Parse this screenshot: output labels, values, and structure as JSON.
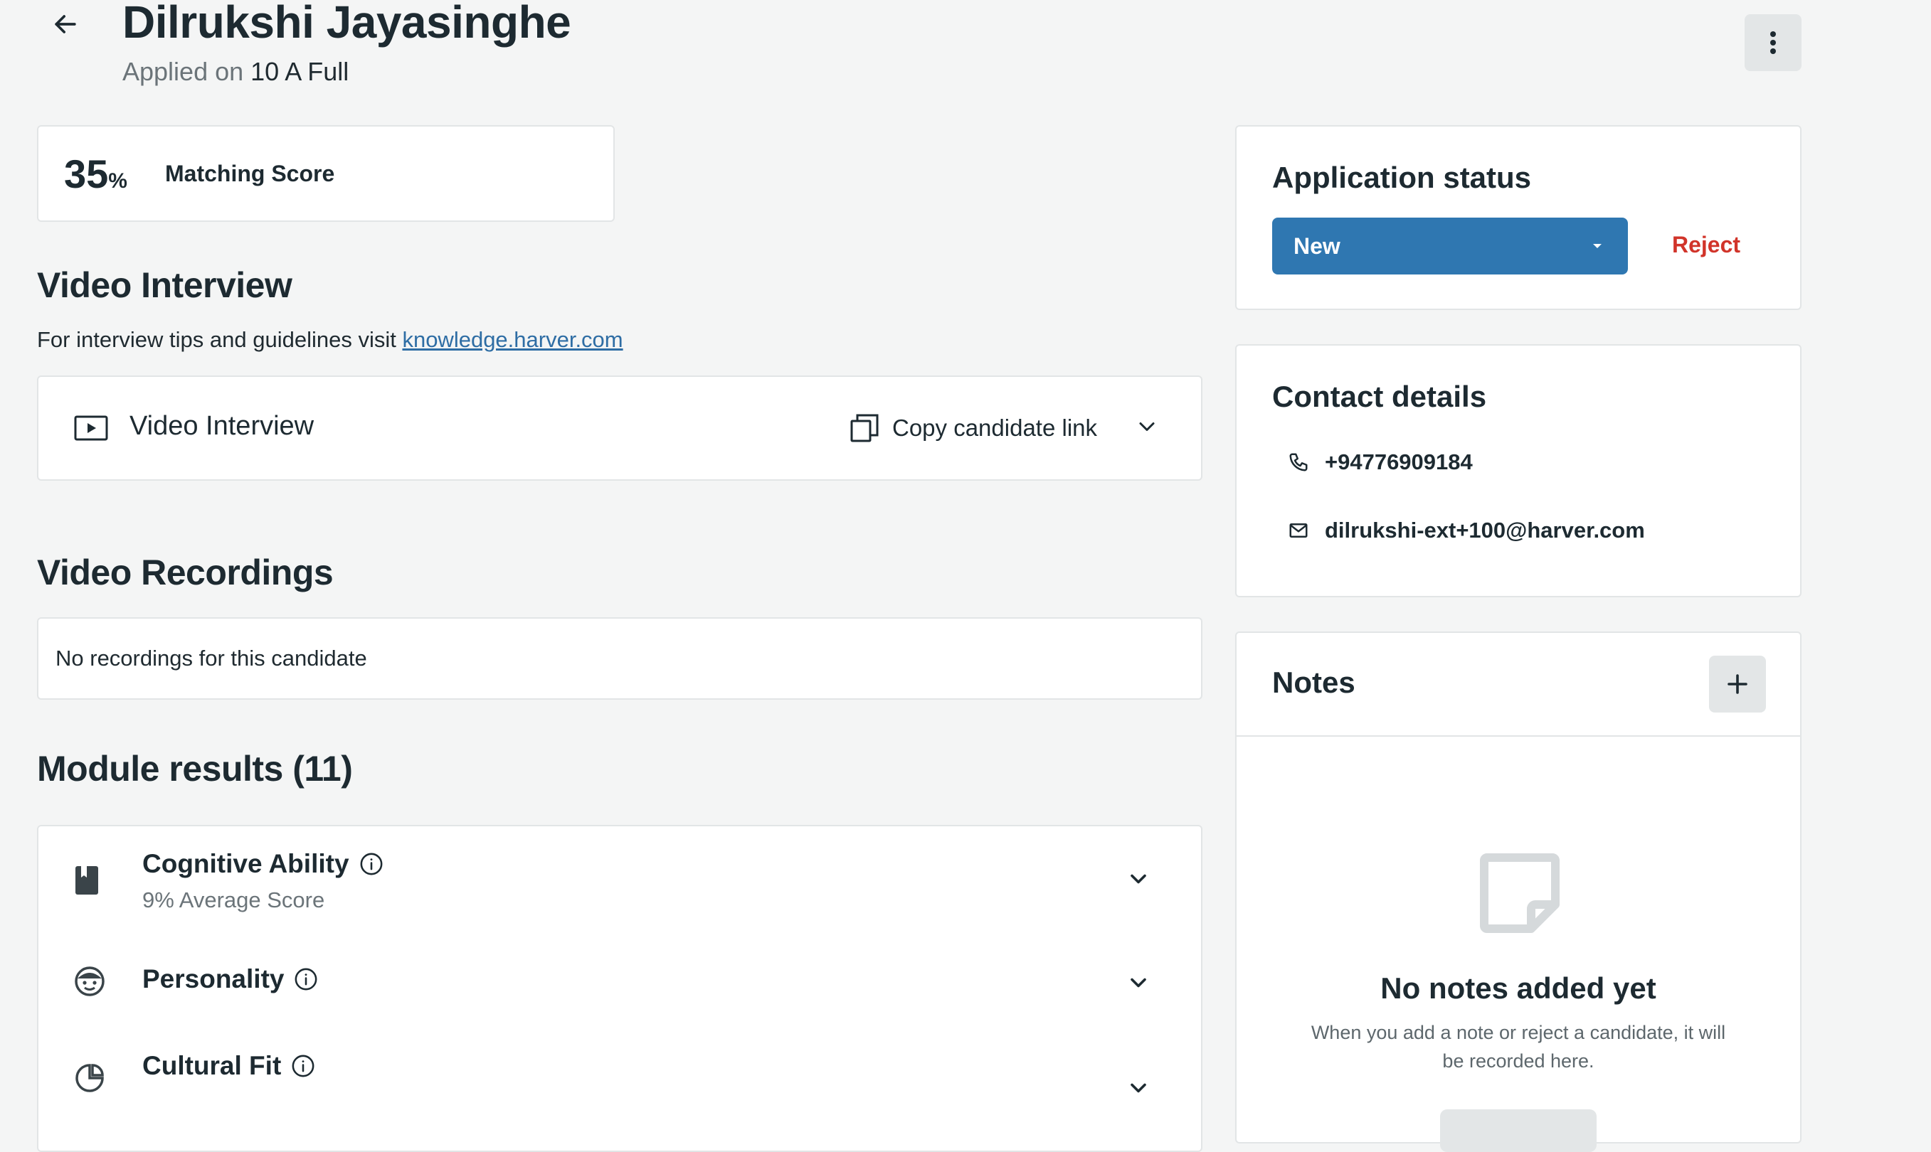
{
  "header": {
    "candidate_name": "Dilrukshi Jayasinghe",
    "applied_prefix": "Applied on",
    "job_name": "10 A Full"
  },
  "score": {
    "value": "35",
    "unit": "%",
    "label": "Matching Score"
  },
  "video_interview": {
    "title": "Video Interview",
    "tips_text": "For interview tips and guidelines visit ",
    "tips_link": "knowledge.harver.com",
    "card_label": "Video Interview",
    "copy_link_label": "Copy candidate link"
  },
  "video_recordings": {
    "title": "Video Recordings",
    "empty_text": "No recordings for this candidate"
  },
  "module_results": {
    "title": "Module results (11)",
    "modules": [
      {
        "name": "Cognitive Ability",
        "subtitle": "9% Average Score",
        "icon": "book-icon"
      },
      {
        "name": "Personality",
        "subtitle": "",
        "icon": "smiley-face-icon"
      },
      {
        "name": "Cultural Fit",
        "subtitle": "",
        "icon": "cultural-fit-icon"
      }
    ]
  },
  "application_status": {
    "title": "Application status",
    "selected": "New",
    "reject_label": "Reject"
  },
  "contact": {
    "title": "Contact details",
    "phone": "+94776909184",
    "email": "dilrukshi-ext+100@harver.com"
  },
  "notes": {
    "title": "Notes",
    "empty_title": "No notes added yet",
    "empty_text": "When you add a note or reject a candidate, it will be recorded here."
  },
  "colors": {
    "background": "#f4f5f5",
    "primary": "#2f77b1",
    "danger": "#d1342a",
    "link": "#2e6da4",
    "text": "#1d2a31"
  }
}
